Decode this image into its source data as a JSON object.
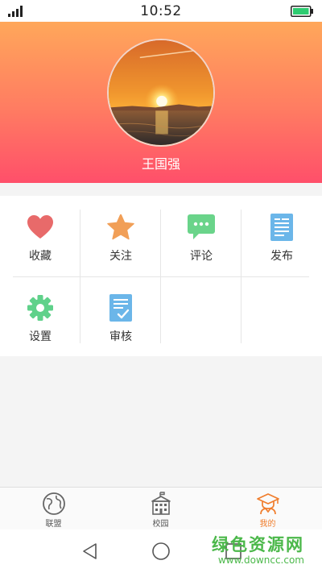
{
  "status_bar": {
    "time": "10:52",
    "signal_icon": "signal-icon",
    "battery_icon": "battery-icon"
  },
  "profile": {
    "username": "王国强",
    "avatar_icon": "sunset-avatar"
  },
  "menu": [
    {
      "label": "收藏",
      "icon": "heart-icon",
      "color": "#e86a6a"
    },
    {
      "label": "关注",
      "icon": "star-icon",
      "color": "#f19f57"
    },
    {
      "label": "评论",
      "icon": "comment-icon",
      "color": "#6ad48a"
    },
    {
      "label": "发布",
      "icon": "document-icon",
      "color": "#6bb6e9"
    },
    {
      "label": "设置",
      "icon": "gear-icon",
      "color": "#5fd18a"
    },
    {
      "label": "审核",
      "icon": "review-icon",
      "color": "#6bb6e9"
    }
  ],
  "tabs": [
    {
      "label": "联盟",
      "icon": "globe-icon",
      "active": false
    },
    {
      "label": "校园",
      "icon": "building-icon",
      "active": false
    },
    {
      "label": "我的",
      "icon": "graduate-icon",
      "active": true
    }
  ],
  "nav": {
    "back": "back-icon",
    "home": "home-icon",
    "recent": "recent-apps-icon"
  },
  "watermark": {
    "title": "绿色资源网",
    "url": "www.downcc.com"
  },
  "colors": {
    "accent": "#f07d2c",
    "header_top": "#ffa75a",
    "header_bottom": "#ff4f6a"
  }
}
